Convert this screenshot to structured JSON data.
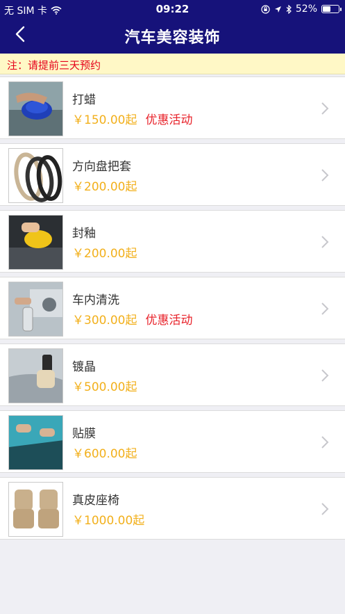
{
  "status_bar": {
    "carrier": "无 SIM 卡",
    "time": "09:22",
    "battery_percent": "52%",
    "battery_level": 0.52
  },
  "nav": {
    "title": "汽车美容装饰",
    "back_icon": "chevron-left-icon"
  },
  "notice": {
    "text": "注：请提前三天预约"
  },
  "colors": {
    "header_bg": "#16127a",
    "price": "#f2b01c",
    "promo": "#e8222a",
    "notice_bg": "#fff8c6"
  },
  "items": [
    {
      "name": "打蜡",
      "price": "￥150.00起",
      "promo": "优惠活动",
      "image": "waxing-photo"
    },
    {
      "name": "方向盘把套",
      "price": "￥200.00起",
      "promo": "",
      "image": "steering-wheel-cover-photo"
    },
    {
      "name": "封釉",
      "price": "￥200.00起",
      "promo": "",
      "image": "glaze-sealing-photo"
    },
    {
      "name": "车内清洗",
      "price": "￥300.00起",
      "promo": "优惠活动",
      "image": "interior-cleaning-photo"
    },
    {
      "name": "镀晶",
      "price": "￥500.00起",
      "promo": "",
      "image": "crystal-coating-photo"
    },
    {
      "name": "贴膜",
      "price": "￥600.00起",
      "promo": "",
      "image": "window-film-photo"
    },
    {
      "name": "真皮座椅",
      "price": "￥1000.00起",
      "promo": "",
      "image": "leather-seats-photo"
    }
  ]
}
